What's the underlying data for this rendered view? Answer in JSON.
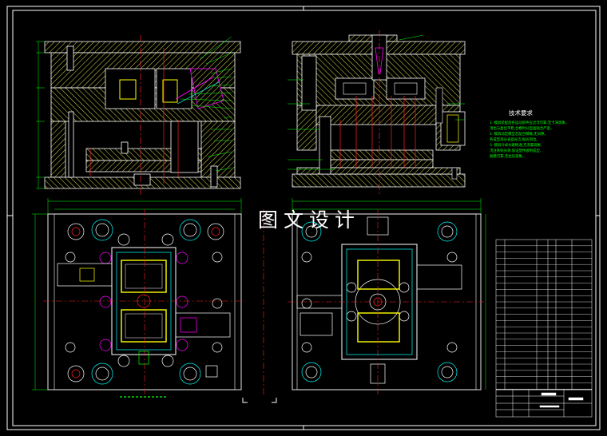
{
  "watermark": "图文设计",
  "tech": {
    "title": "技术要求",
    "lines": [
      "1. 模具装配后各运动部件应灵活可靠,无卡滞现象。",
      "顶出与复位平稳,合模时分型面贴合严密。",
      "2. 模具动定模型芯配合精确,无间隙。",
      "各成型部分表面光洁,抛光到位。",
      "3. 模具冷却水路畅通,无渗漏现象,",
      "浇注系统光滑,保证塑件顺利成型,",
      "脱模可靠,无拉伤现象。"
    ]
  },
  "colors": {
    "background": "#000000",
    "frame": "#ffffff",
    "hatch": "#c8c84a",
    "outline": "#ffffff",
    "center": "#ff2020",
    "accent": "#ff00ff",
    "cyan": "#00ffff",
    "text_green": "#00ff00",
    "part_yellow": "#ffff00"
  }
}
